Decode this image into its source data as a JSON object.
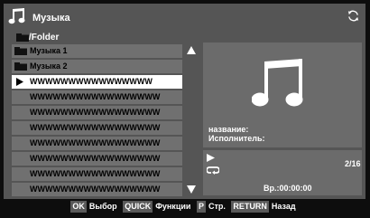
{
  "header": {
    "title": "Музыка",
    "app_icon": "music-note-icon",
    "refresh_icon": "refresh-icon"
  },
  "path": {
    "label": "/Folder",
    "icon": "folder-icon"
  },
  "list": {
    "items": [
      {
        "type": "folder",
        "label": "Музыка 1"
      },
      {
        "type": "folder",
        "label": "Музыка 2"
      },
      {
        "type": "file",
        "label": "WWWWWWWWWWWWWWWW",
        "selected": true,
        "playing": true
      },
      {
        "type": "file",
        "label": "WWWWWWWWWWWWWWWWW"
      },
      {
        "type": "file",
        "label": "WWWWWWWWWWWWWWWWW"
      },
      {
        "type": "file",
        "label": "WWWWWWWWWWWWWWWWW"
      },
      {
        "type": "file",
        "label": "WWWWWWWWWWWWWWWWW"
      },
      {
        "type": "file",
        "label": "WWWWWWWWWWWWWWWWW"
      },
      {
        "type": "file",
        "label": "WWWWWWWWWWWWWWWWW"
      },
      {
        "type": "file",
        "label": "WWWWWWWWWWWWWWWWW"
      }
    ]
  },
  "info": {
    "title_label": "название:",
    "artist_label": "Исполнитель:"
  },
  "playback": {
    "counter": "2/16",
    "elapsed": "Вр.:00:00:00"
  },
  "footer": {
    "ok_key": "OK",
    "ok_desc": "Выбор",
    "quick_key": "QUICK",
    "quick_desc": "Функции",
    "p_key": "P",
    "p_desc": "Стр.",
    "return_key": "RETURN",
    "return_desc": "Назад"
  },
  "colors": {
    "panel": "#555555",
    "row": "#707070",
    "selected_row": "#ffffff",
    "background": "#0d0d0d"
  }
}
